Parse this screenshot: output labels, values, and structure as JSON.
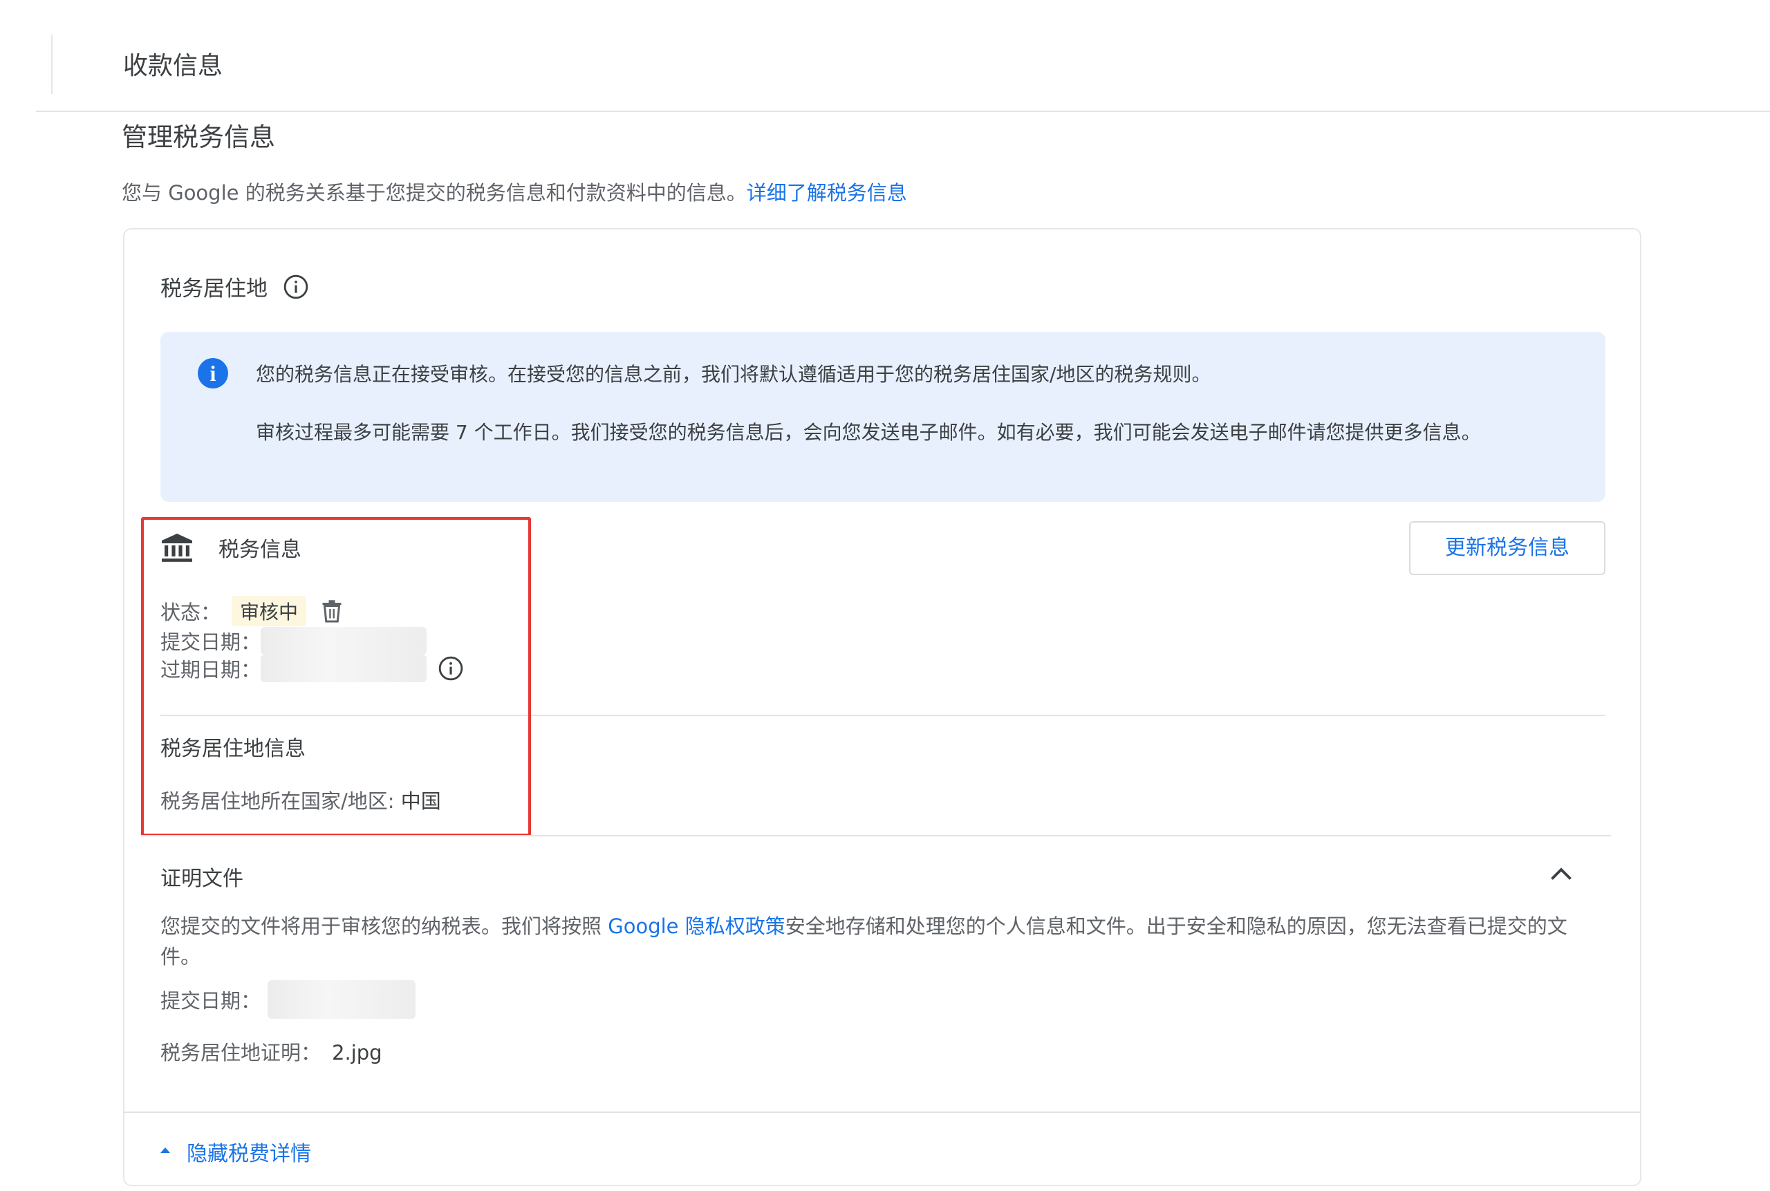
{
  "header": {
    "title": "收款信息"
  },
  "section": {
    "title": "管理税务信息",
    "intro_text": "您与 Google 的税务关系基于您提交的税务信息和付款资料中的信息。",
    "learn_more_link": "详细了解税务信息"
  },
  "card": {
    "residence_heading": "税务居住地",
    "notice": {
      "line1": "您的税务信息正在接受审核。在接受您的信息之前，我们将默认遵循适用于您的税务居住国家/地区的税务规则。",
      "line2": "审核过程最多可能需要 7 个工作日。我们接受您的税务信息后，会向您发送电子邮件。如有必要，我们可能会发送电子邮件请您提供更多信息。"
    },
    "tax_info": {
      "heading": "税务信息",
      "update_button": "更新税务信息",
      "status_label": "状态：",
      "status_value": "审核中",
      "submit_date_label": "提交日期：",
      "expire_date_label": "过期日期："
    },
    "residence_info": {
      "heading": "税务居住地信息",
      "country_label": "税务居住地所在国家/地区: ",
      "country_value": "中国"
    },
    "proof": {
      "heading": "证明文件",
      "desc_before": "您提交的文件将用于审核您的纳税表。我们将按照 ",
      "desc_link": "Google 隐私权政策",
      "desc_after": "安全地存储和处理您的个人信息和文件。出于安全和隐私的原因，您无法查看已提交的文件。",
      "submit_date_label": "提交日期：",
      "file_label": "税务居住地证明：",
      "file_value": "2.jpg"
    },
    "hide_details_link": "隐藏税费详情"
  },
  "colors": {
    "link": "#1a73e8",
    "notice_bg": "#e8f0fe",
    "status_badge_bg": "#fef7e0",
    "highlight_frame": "#e53935"
  },
  "icons": {
    "info": "info-circle-icon",
    "notice": "info-filled-icon",
    "bank": "bank-icon",
    "trash": "trash-icon",
    "chevron": "chevron-up-icon",
    "triangle": "triangle-up-icon"
  }
}
